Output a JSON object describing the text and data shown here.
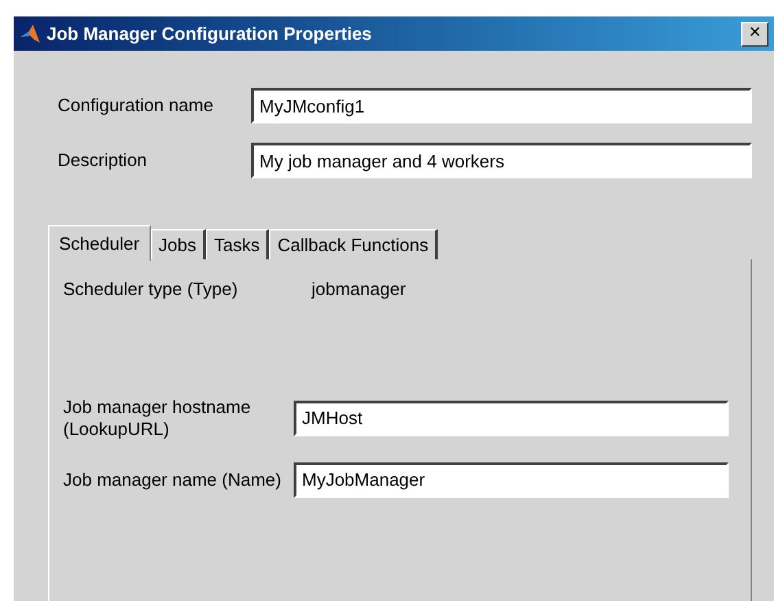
{
  "window": {
    "title": "Job Manager Configuration Properties",
    "close": "✕"
  },
  "fields": [
    {
      "label": "Configuration name",
      "value": "MyJMconfig1"
    },
    {
      "label": "Description",
      "value": "My job manager and 4 workers"
    }
  ],
  "tabs": [
    {
      "label": "Scheduler",
      "selected": true
    },
    {
      "label": "Jobs",
      "selected": false
    },
    {
      "label": "Tasks",
      "selected": false
    },
    {
      "label": "Callback Functions",
      "selected": false
    }
  ],
  "scheduler_tab": {
    "type_label": "Scheduler type (Type)",
    "type_value": "jobmanager",
    "fields": [
      {
        "label": "Job manager hostname (LookupURL)",
        "value": "JMHost"
      },
      {
        "label": "Job manager name (Name)",
        "value": "MyJobManager"
      }
    ]
  }
}
